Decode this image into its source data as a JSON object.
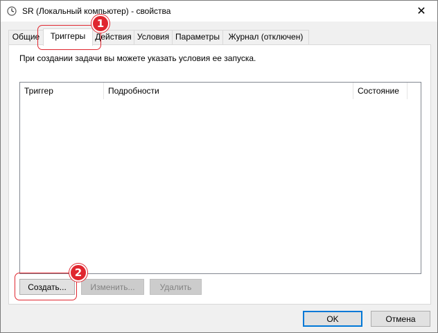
{
  "window": {
    "title": "SR (Локальный компьютер) - свойства",
    "close_glyph": "✕"
  },
  "tabs": [
    {
      "label": "Общие",
      "active": false
    },
    {
      "label": "Триггеры",
      "active": true
    },
    {
      "label": "Действия",
      "active": false
    },
    {
      "label": "Условия",
      "active": false
    },
    {
      "label": "Параметры",
      "active": false
    },
    {
      "label": "Журнал (отключен)",
      "active": false
    }
  ],
  "triggers": {
    "description": "При создании задачи вы можете указать условия ее запуска.",
    "columns": [
      "Триггер",
      "Подробности",
      "Состояние"
    ],
    "rows": [],
    "buttons": {
      "create": "Создать...",
      "edit": "Изменить...",
      "delete": "Удалить"
    }
  },
  "footer": {
    "ok": "OK",
    "cancel": "Отмена"
  },
  "annotations": [
    {
      "number": "1"
    },
    {
      "number": "2"
    }
  ],
  "colors": {
    "annotation": "#e0262f",
    "default_button_border": "#0078d7"
  },
  "icons": {
    "title_icon": "clock-icon",
    "close": "close-icon"
  }
}
